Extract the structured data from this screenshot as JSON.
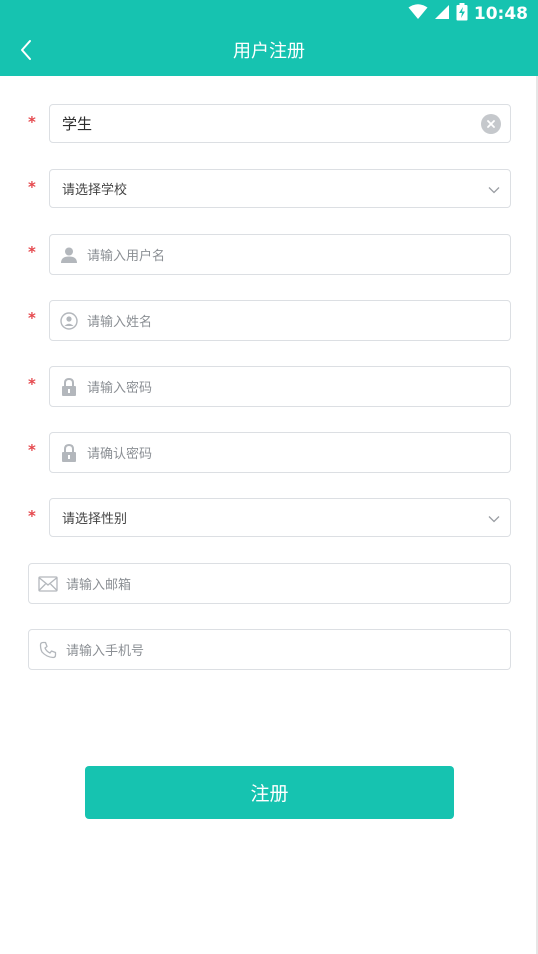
{
  "status_bar": {
    "time": "10:48",
    "icons": [
      "wifi-icon",
      "cell-signal-icon",
      "battery-charging-icon"
    ]
  },
  "app_bar": {
    "title": "用户注册",
    "back_icon": "chevron-left-icon"
  },
  "colors": {
    "accent": "#16c3b0",
    "required": "#e5484d",
    "border": "#dcdfe3",
    "placeholder": "#8b8f94"
  },
  "form": {
    "required_mark": "*",
    "identity": {
      "value": "学生",
      "clear_icon": "clear-icon"
    },
    "school": {
      "placeholder": "请选择学校",
      "icon": "chevron-down-icon"
    },
    "username": {
      "placeholder": "请输入用户名",
      "icon": "user-icon"
    },
    "real_name": {
      "placeholder": "请输入姓名",
      "icon": "user-circle-icon"
    },
    "password": {
      "placeholder": "请输入密码",
      "icon": "lock-icon"
    },
    "confirm_password": {
      "placeholder": "请确认密码",
      "icon": "lock-icon"
    },
    "gender": {
      "placeholder": "请选择性别",
      "icon": "chevron-down-icon"
    },
    "email": {
      "placeholder": "请输入邮箱",
      "icon": "mail-icon"
    },
    "phone": {
      "placeholder": "请输入手机号",
      "icon": "phone-icon"
    }
  },
  "submit_label": "注册"
}
